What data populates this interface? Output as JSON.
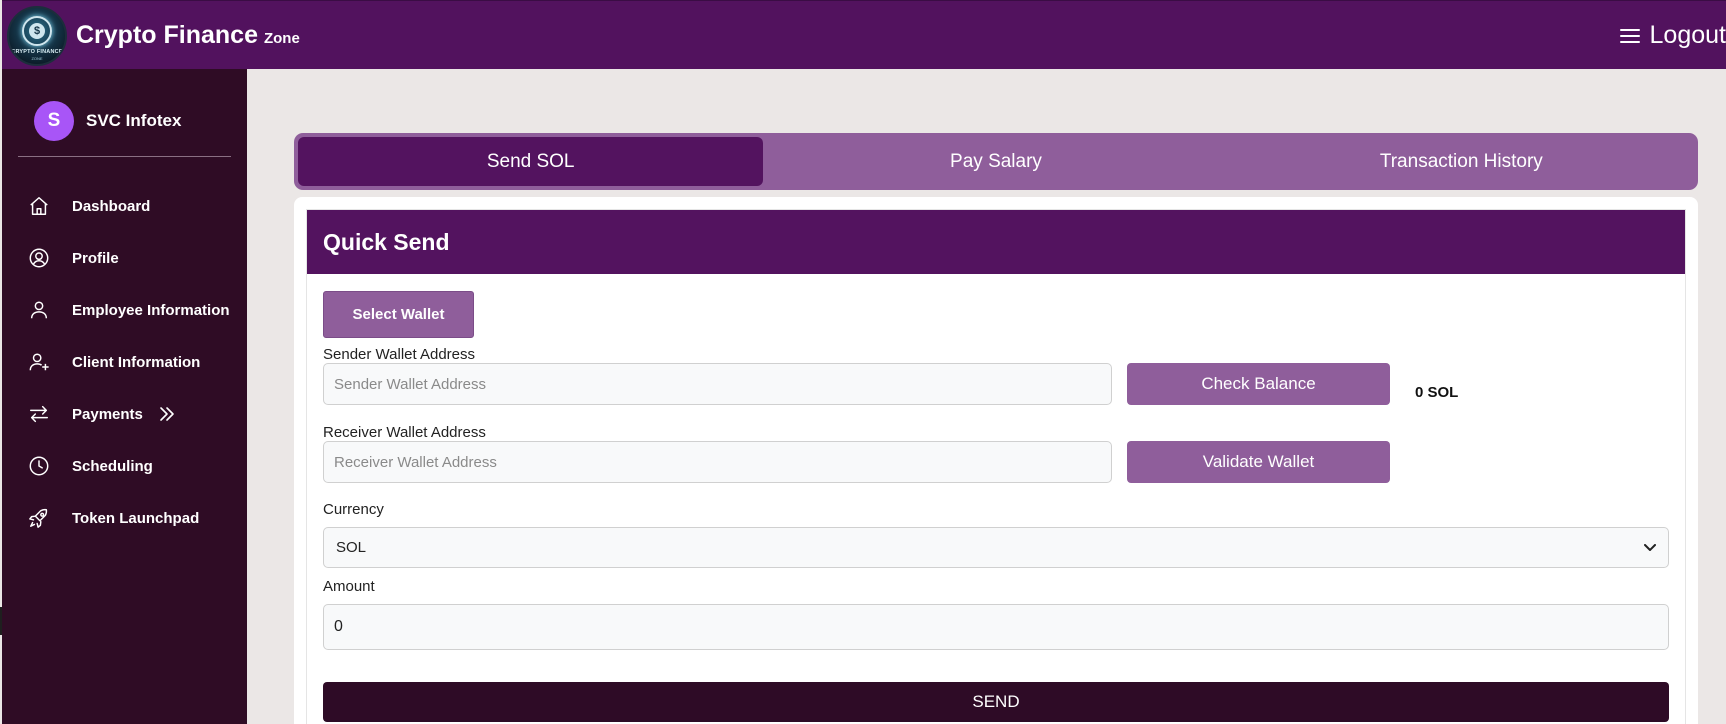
{
  "header": {
    "brand_name": "Crypto Finance",
    "brand_suffix": "Zone",
    "logo_text": "CRYPTO FINANCE",
    "logo_subtext": "ZONE",
    "logout_label": "Logout",
    "menu_icon": "hamburger-icon"
  },
  "sidebar": {
    "user": {
      "initial": "S",
      "name": "SVC Infotex"
    },
    "items": [
      {
        "label": "Dashboard",
        "icon": "home-icon"
      },
      {
        "label": "Profile",
        "icon": "user-circle-icon"
      },
      {
        "label": "Employee Information",
        "icon": "user-icon"
      },
      {
        "label": "Client Information",
        "icon": "user-plus-icon"
      },
      {
        "label": "Payments",
        "icon": "arrows-exchange-icon"
      },
      {
        "label": "Scheduling",
        "icon": "clock-icon"
      },
      {
        "label": "Token Launchpad",
        "icon": "rocket-icon"
      }
    ]
  },
  "tabs": [
    {
      "label": "Send SOL",
      "active": true
    },
    {
      "label": "Pay Salary",
      "active": false
    },
    {
      "label": "Transaction History",
      "active": false
    }
  ],
  "quick_send": {
    "title": "Quick Send",
    "select_wallet_label": "Select Wallet",
    "sender_label": "Sender Wallet Address",
    "sender_placeholder": "Sender Wallet Address",
    "check_balance_label": "Check Balance",
    "balance": "0 SOL",
    "receiver_label": "Receiver Wallet Address",
    "receiver_placeholder": "Receiver Wallet Address",
    "validate_label": "Validate Wallet",
    "currency_label": "Currency",
    "currency_value": "SOL",
    "amount_label": "Amount",
    "amount_value": "0",
    "send_label": "SEND"
  },
  "colors": {
    "header_bg": "#52125e",
    "sidebar_bg": "#2f0c25",
    "accent": "#8f5e9b",
    "send_bg": "#2e0b26",
    "avatar": "#a855f7",
    "page_bg": "#ebe7e6"
  }
}
